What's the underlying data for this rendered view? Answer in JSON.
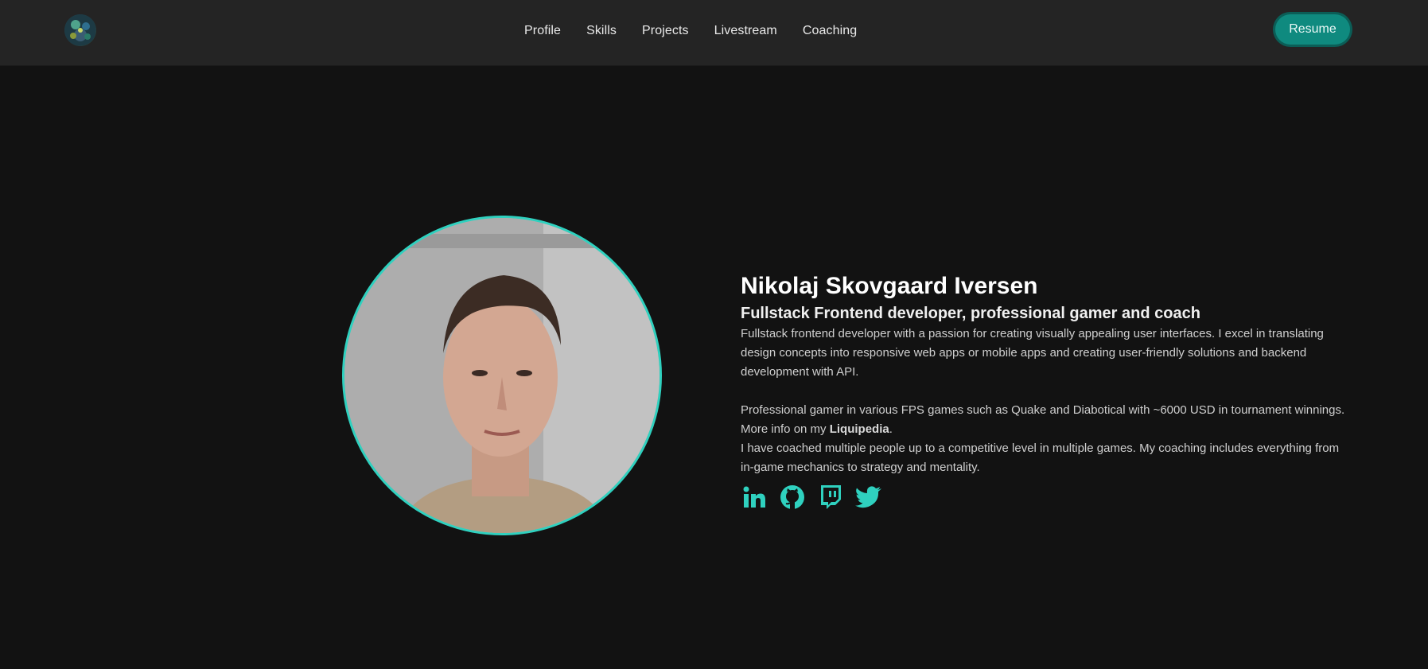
{
  "nav": {
    "links": [
      "Profile",
      "Skills",
      "Projects",
      "Livestream",
      "Coaching"
    ],
    "resume_label": "Resume"
  },
  "hero": {
    "name": "Nikolaj Skovgaard Iversen",
    "tagline": "Fullstack Frontend developer, professional gamer and coach",
    "para1": "Fullstack frontend developer with a passion for creating visually appealing user interfaces. I excel in translating design concepts into responsive web apps or mobile apps and creating user-friendly solutions and backend development with API.",
    "para2": "Professional gamer in various FPS games such as Quake and Diabotical with ~6000 USD in tournament winnings.",
    "more_info_prefix": "More info on my ",
    "liquipedia_label": "Liquipedia",
    "more_info_suffix": ".",
    "para3": "I have coached multiple people up to a competitive level in multiple games. My coaching includes everything from in-game mechanics to strategy and mentality."
  },
  "socials": [
    "linkedin-icon",
    "github-icon",
    "twitch-icon",
    "twitter-icon"
  ],
  "colors": {
    "accent": "#2fd1bf",
    "button": "#0f8a7f",
    "nav_bg": "#242424",
    "page_bg": "#121212"
  }
}
